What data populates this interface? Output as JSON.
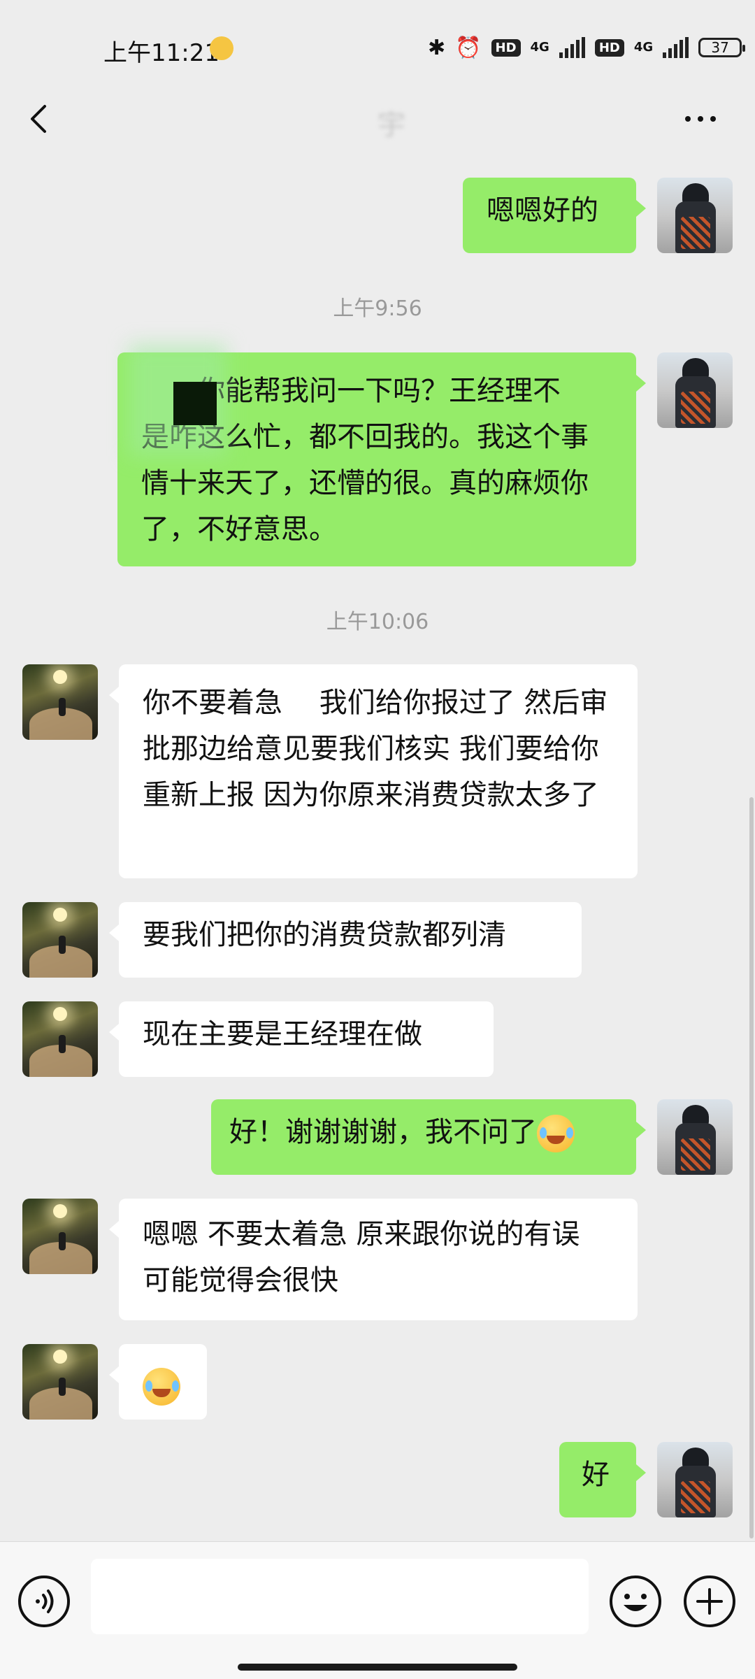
{
  "status_bar": {
    "time": "上午11:21",
    "battery": "37",
    "network_1": "4G",
    "network_2": "4G",
    "hd_1": "HD",
    "hd_2": "HD"
  },
  "nav": {
    "title": "宇"
  },
  "messages": [
    {
      "sender": "me",
      "text": "嗯嗯好的"
    },
    {
      "timestamp": "上午9:56"
    },
    {
      "sender": "me",
      "text": "　　你能帮我问一下吗？王经理不　　是咋这么忙，都不回我的。我这个事情十来天了，还懵的很。真的麻烦你了，不好意思。"
    },
    {
      "timestamp": "上午10:06"
    },
    {
      "sender": "other",
      "text": "你不要着急　 我们给你报过了 然后审批那边给意见要我们核实 我们要给你重新上报 因为你原来消费贷款太多了"
    },
    {
      "sender": "other",
      "text": "要我们把你的消费贷款都列清"
    },
    {
      "sender": "other",
      "text": "现在主要是王经理在做"
    },
    {
      "sender": "me",
      "text": "好！谢谢谢谢，我不问了",
      "emoji": "crying-laughing"
    },
    {
      "sender": "other",
      "text": "嗯嗯 不要太着急  原来跟你说的有误 可能觉得会很快"
    },
    {
      "sender": "other",
      "emoji": "crying-laughing"
    },
    {
      "sender": "me",
      "text": "好"
    }
  ],
  "input": {
    "placeholder": ""
  },
  "icons": {
    "back": "chevron-left-icon",
    "more": "more-dots-icon",
    "voice": "voice-icon",
    "emoji": "emoji-icon",
    "plus": "plus-icon"
  }
}
